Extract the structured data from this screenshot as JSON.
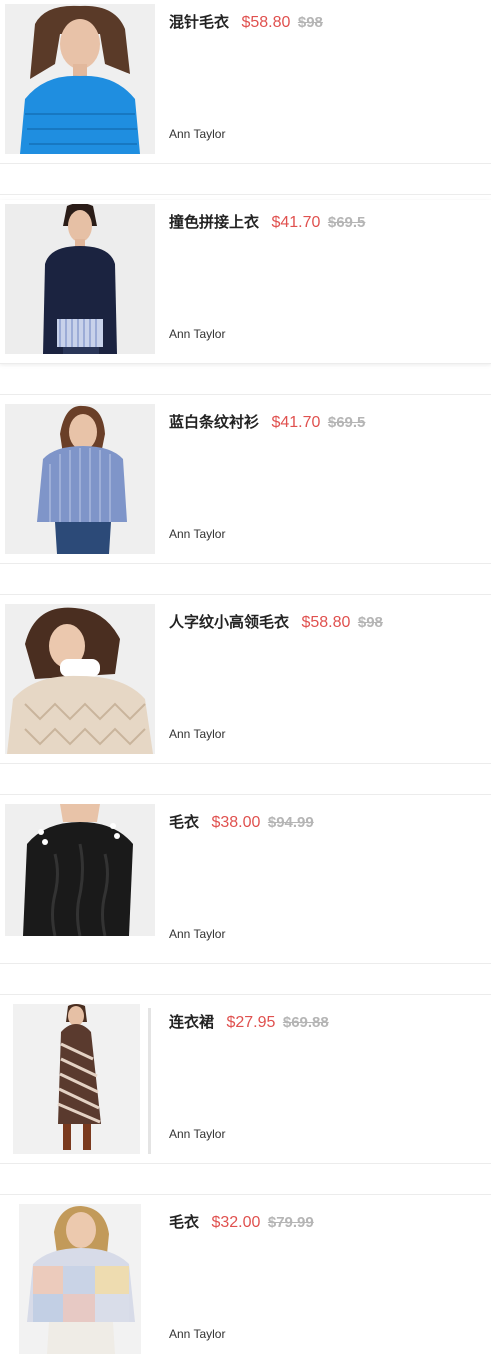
{
  "products": [
    {
      "title": "混针毛衣",
      "price": "$58.80",
      "original_price": "$98",
      "brand": "Ann Taylor",
      "image": "model-blue-sweater",
      "accent": "#1f8ee0"
    },
    {
      "title": "撞色拼接上衣",
      "price": "$41.70",
      "original_price": "$69.5",
      "brand": "Ann Taylor",
      "image": "model-navy-layered-top",
      "accent": "#1b2340"
    },
    {
      "title": "蓝白条纹衬衫",
      "price": "$41.70",
      "original_price": "$69.5",
      "brand": "Ann Taylor",
      "image": "model-striped-shirt",
      "accent": "#7f95c9"
    },
    {
      "title": "人字纹小高领毛衣",
      "price": "$58.80",
      "original_price": "$98",
      "brand": "Ann Taylor",
      "image": "model-chevron-sweater",
      "accent": "#d9c7b3"
    },
    {
      "title": "毛衣",
      "price": "$38.00",
      "original_price": "$94.99",
      "brand": "Ann Taylor",
      "image": "model-black-cable-sweater",
      "accent": "#1a1a1a"
    },
    {
      "title": "连衣裙",
      "price": "$27.95",
      "original_price": "$69.88",
      "brand": "Ann Taylor",
      "image": "model-print-dress",
      "accent": "#5a3a2e"
    },
    {
      "title": "毛衣",
      "price": "$32.00",
      "original_price": "$79.99",
      "brand": "Ann Taylor",
      "image": "model-plaid-sweater",
      "accent": "#c9d3e6"
    }
  ]
}
